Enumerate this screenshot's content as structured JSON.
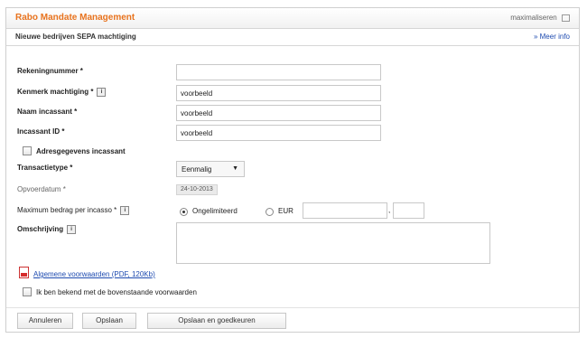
{
  "app": {
    "title": "Rabo Mandate Management",
    "maximize_label": "maximaliseren"
  },
  "page": {
    "title": "Nieuwe bedrijven SEPA machtiging",
    "more_info": "» Meer info"
  },
  "form": {
    "rekeningnummer": {
      "label": "Rekeningnummer *",
      "value": ""
    },
    "kenmerk": {
      "label": "Kenmerk machtiging *",
      "value": "voorbeeld"
    },
    "naam": {
      "label": "Naam incassant *",
      "value": "voorbeeld"
    },
    "incassant_id": {
      "label": "Incassant ID *",
      "value": "voorbeeld"
    },
    "adres_checkbox": {
      "label": "Adresgegevens incassant",
      "checked": false
    },
    "transactietype": {
      "label": "Transactietype *",
      "selected": "Eenmalig"
    },
    "opvoerdatum": {
      "label": "Opvoerdatum *",
      "value": "24-10-2013"
    },
    "maximum": {
      "label": "Maximum bedrag per incasso *",
      "option_unlimited": "Ongelimiteerd",
      "option_eur": "EUR",
      "selected": "Ongelimiteerd",
      "amount": "",
      "cents": ""
    },
    "omschrijving": {
      "label": "Omschrijving",
      "value": ""
    },
    "terms_link": "Algemene voorwaarden (PDF, 120Kb)",
    "terms_checkbox": {
      "label": "Ik ben bekend met de bovenstaande voorwaarden",
      "checked": false
    }
  },
  "icons": {
    "info": "info-icon",
    "pdf": "pdf-icon",
    "maximize": "maximize-icon"
  },
  "colors": {
    "title": "#e8731e",
    "link": "#1e4bb0"
  },
  "buttons": {
    "cancel": "Annuleren",
    "save": "Opslaan",
    "save_approve": "Opslaan en goedkeuren"
  }
}
